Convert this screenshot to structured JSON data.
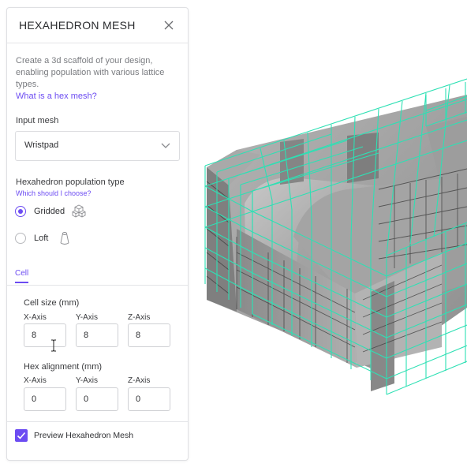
{
  "panel": {
    "title": "HEXAHEDRON MESH",
    "description": "Create a 3d scaffold of your design, enabling population with various lattice types.",
    "help_link": "What is a hex mesh?",
    "input_mesh": {
      "label": "Input mesh",
      "selected": "Wristpad"
    },
    "population": {
      "label": "Hexahedron population type",
      "help_link": "Which should I choose?",
      "options": [
        {
          "label": "Gridded",
          "selected": true,
          "icon": "cube-grid-icon"
        },
        {
          "label": "Loft",
          "selected": false,
          "icon": "loft-icon"
        }
      ]
    },
    "tabs": [
      {
        "label": "Cell",
        "active": true
      }
    ],
    "cell_size": {
      "label": "Cell size (mm)",
      "x_label": "X-Axis",
      "y_label": "Y-Axis",
      "z_label": "Z-Axis",
      "x": "8",
      "y": "8",
      "z": "8"
    },
    "hex_alignment": {
      "label": "Hex alignment (mm)",
      "x_label": "X-Axis",
      "y_label": "Y-Axis",
      "z_label": "Z-Axis",
      "x": "0",
      "y": "0",
      "z": "0"
    },
    "preview": {
      "label": "Preview Hexahedron Mesh",
      "checked": true
    }
  },
  "colors": {
    "accent": "#6c4cf2",
    "mesh_wire": "#2ee0b4",
    "model_gray": "#9a9a9a"
  },
  "icons": [
    "close-icon",
    "chevron-down-icon",
    "cube-grid-icon",
    "loft-icon",
    "checkmark-icon",
    "text-cursor-icon"
  ]
}
